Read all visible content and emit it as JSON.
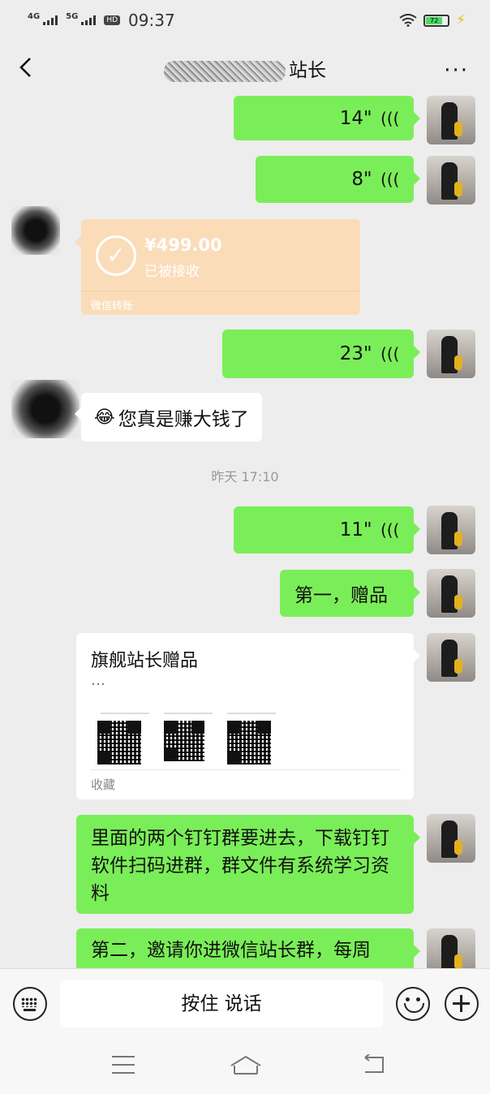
{
  "status_bar": {
    "net1": "4G",
    "net2": "5G",
    "hd": "HD",
    "sim": "1",
    "time": "09:37",
    "battery": "72"
  },
  "header": {
    "title_visible": "站长",
    "more": "···"
  },
  "messages": {
    "voice1": "14\"",
    "voice2": "8\"",
    "transfer": {
      "amount": "¥499.00",
      "status": "已被接收",
      "label": "微信转账"
    },
    "voice3": "23\"",
    "reply": "您真是赚大钱了",
    "timestamp": "昨天 17:10",
    "voice4": "11\"",
    "gift": "第一，赠品",
    "card": {
      "title": "旗舰站长赠品",
      "ellipsis": "…",
      "source": "收藏"
    },
    "long_text": "里面的两个钉钉群要进去，下载钉钉软件扫码进群，群文件有系统学习资料",
    "partial_text": "第二，邀请你进微信站长群，每周"
  },
  "input_bar": {
    "talk_label": "按住 说话"
  },
  "icons": {
    "back": "chevron-left-icon",
    "more": "more-icon",
    "voice": "voice-wave-icon",
    "keyboard": "keyboard-icon",
    "emoji": "emoji-icon",
    "plus": "plus-icon",
    "check": "check-circle-icon",
    "cry_laugh": "tears-of-joy-emoji"
  },
  "colors": {
    "chat_bg": "#ededed",
    "self_bubble": "#7aee58",
    "other_bubble": "#ffffff",
    "transfer_bg": "#fbdcb9"
  }
}
